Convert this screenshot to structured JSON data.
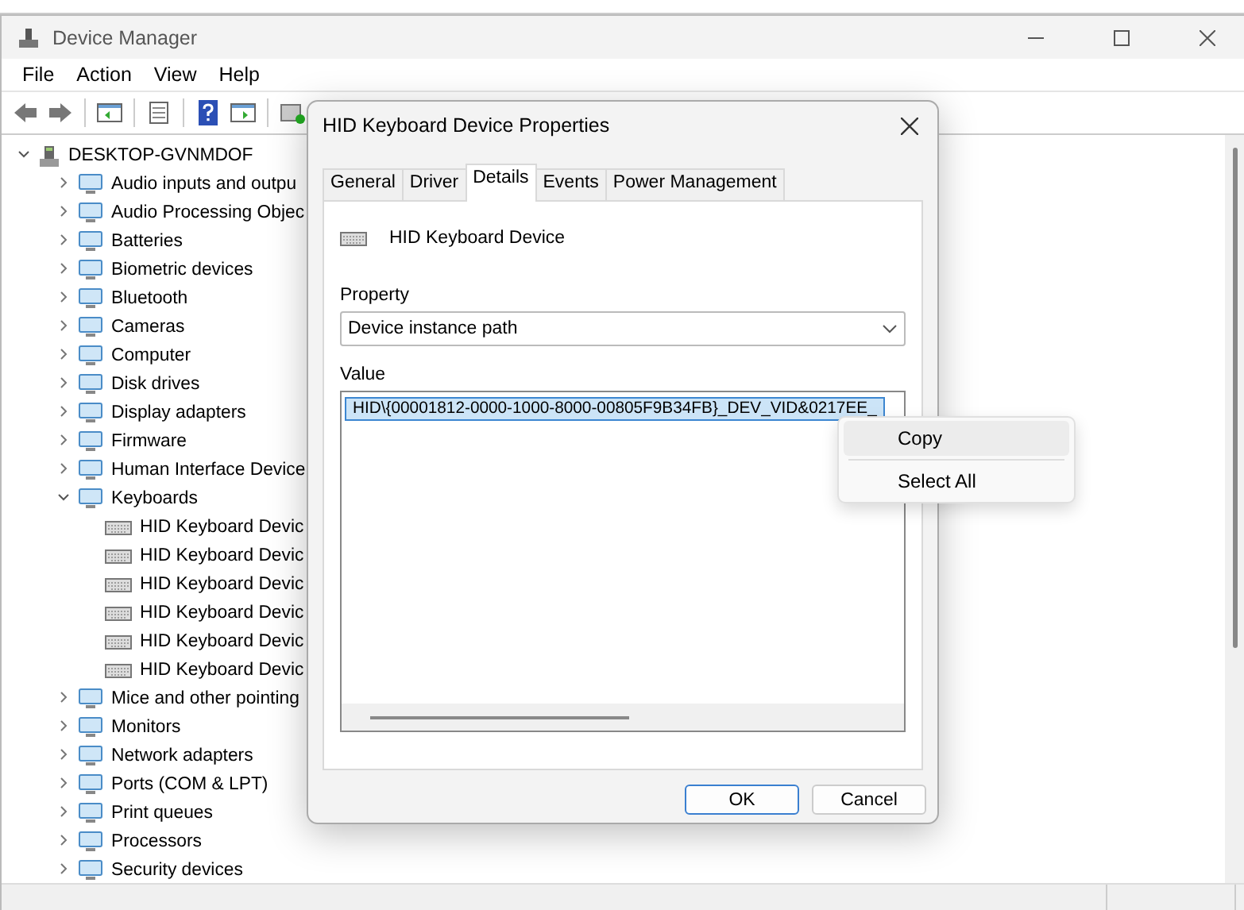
{
  "window": {
    "title": "Device Manager"
  },
  "menu": [
    "File",
    "Action",
    "View",
    "Help"
  ],
  "tree": {
    "label": "DESKTOP-GVNMDOF",
    "expanded": true,
    "children": [
      {
        "label": "Audio inputs and outpu",
        "expanded": false
      },
      {
        "label": "Audio Processing Objec",
        "expanded": false
      },
      {
        "label": "Batteries",
        "expanded": false
      },
      {
        "label": "Biometric devices",
        "expanded": false
      },
      {
        "label": "Bluetooth",
        "expanded": false
      },
      {
        "label": "Cameras",
        "expanded": false
      },
      {
        "label": "Computer",
        "expanded": false
      },
      {
        "label": "Disk drives",
        "expanded": false
      },
      {
        "label": "Display adapters",
        "expanded": false
      },
      {
        "label": "Firmware",
        "expanded": false
      },
      {
        "label": "Human Interface Device",
        "expanded": false
      },
      {
        "label": "Keyboards",
        "expanded": true,
        "children": [
          {
            "label": "HID Keyboard Devic"
          },
          {
            "label": "HID Keyboard Devic"
          },
          {
            "label": "HID Keyboard Devic"
          },
          {
            "label": "HID Keyboard Devic"
          },
          {
            "label": "HID Keyboard Devic"
          },
          {
            "label": "HID Keyboard Devic"
          }
        ]
      },
      {
        "label": "Mice and other pointing",
        "expanded": false
      },
      {
        "label": "Monitors",
        "expanded": false
      },
      {
        "label": "Network adapters",
        "expanded": false
      },
      {
        "label": "Ports (COM & LPT)",
        "expanded": false
      },
      {
        "label": "Print queues",
        "expanded": false
      },
      {
        "label": "Processors",
        "expanded": false
      },
      {
        "label": "Security devices",
        "expanded": false
      }
    ]
  },
  "dialog": {
    "title": "HID Keyboard Device Properties",
    "tabs": [
      {
        "label": "General",
        "selected": false
      },
      {
        "label": "Driver",
        "selected": false
      },
      {
        "label": "Details",
        "selected": true
      },
      {
        "label": "Events",
        "selected": false
      },
      {
        "label": "Power Management",
        "selected": false
      }
    ],
    "device_name": "HID Keyboard Device",
    "property": {
      "label": "Property",
      "value": "Device instance path"
    },
    "value": {
      "label": "Value",
      "items": [
        {
          "text": "HID\\{00001812-0000-1000-8000-00805F9B34FB}_DEV_VID&0217EE_",
          "selected": true
        }
      ]
    },
    "buttons": [
      {
        "label": "OK",
        "default": true
      },
      {
        "label": "Cancel",
        "default": false
      }
    ]
  },
  "context_menu": {
    "items": [
      {
        "kind": "item",
        "label": "Copy",
        "hovered": true
      },
      {
        "kind": "separator"
      },
      {
        "kind": "item",
        "label": "Select All",
        "hovered": false
      }
    ]
  }
}
